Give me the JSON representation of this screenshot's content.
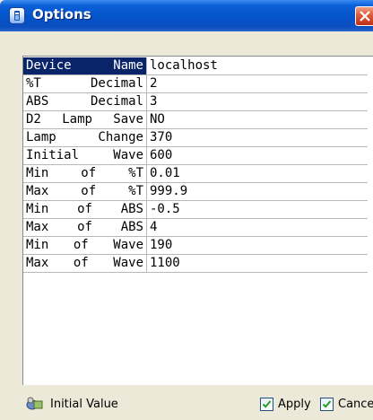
{
  "window": {
    "title": "Options",
    "close_icon": "close-icon",
    "app_icon": "app-icon"
  },
  "properties": [
    {
      "key": "Device  Name",
      "value": "localhost",
      "selected": true
    },
    {
      "key": "%T  Decimal",
      "value": "2"
    },
    {
      "key": "ABS  Decimal",
      "value": "3"
    },
    {
      "key": "D2 Lamp Save",
      "value": "NO"
    },
    {
      "key": "Lamp  Change",
      "value": "370"
    },
    {
      "key": "Initial  Wave",
      "value": "600"
    },
    {
      "key": "Min  of  %T",
      "value": "0.01"
    },
    {
      "key": "Max  of  %T",
      "value": "999.9"
    },
    {
      "key": "Min  of  ABS",
      "value": "-0.5"
    },
    {
      "key": "Max  of  ABS",
      "value": "4"
    },
    {
      "key": "Min  of  Wave",
      "value": "190"
    },
    {
      "key": "Max  of  Wave",
      "value": "1100"
    }
  ],
  "footer": {
    "initial_label": "Initial Value",
    "initial_icon": "reset-icon",
    "apply_label": "Apply",
    "apply_checked": true,
    "cancel_label": "Cance",
    "cancel_checked": true
  },
  "colors": {
    "titlebar": "#0553c8",
    "selected_key_bg": "#0a246a",
    "window_bg": "#ece9d8"
  }
}
